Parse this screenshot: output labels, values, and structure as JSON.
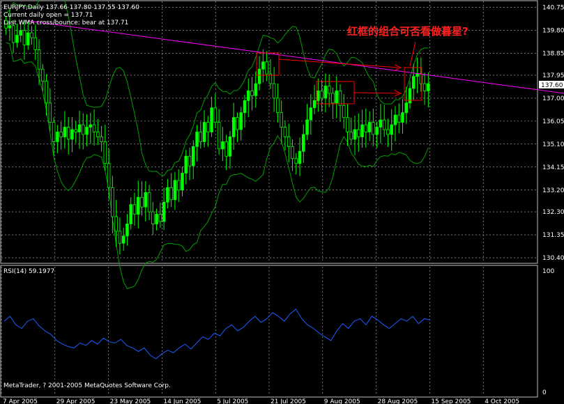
{
  "header": {
    "symbol_line": "EURJPY,Daily  137.66 137.80 137.55 137.60",
    "open_line": "Current daily open = 137.71",
    "wma_line": "Last WMA cross/bounce: bear at 137.71"
  },
  "annotation": "红框的组合可否看做暮星?",
  "copyright": "MetaTrader, ? 2001-2005 MetaQuotes Software Corp.",
  "current_price": "137.60",
  "colors": {
    "background": "#000000",
    "candle_up": "#00ff00",
    "candle_down": "#00ff00",
    "bands": "#00a000",
    "trendline": "#ff00ff",
    "rsi": "#1e5cff",
    "boxes": "#ff0000",
    "grid": "#c0c0c0"
  },
  "chart_data": [
    {
      "type": "candlestick",
      "title": "EURJPY,Daily",
      "y_ticks": [
        140.75,
        139.8,
        138.85,
        137.95,
        137.0,
        136.05,
        135.1,
        134.15,
        133.2,
        132.3,
        131.35,
        130.4
      ],
      "ylim": [
        130.2,
        141.0
      ],
      "x_ticks": [
        "7 Apr 2005",
        "29 Apr 2005",
        "23 May 2005",
        "14 Jun 2005",
        "5 Jul 2005",
        "21 Jul 2005",
        "9 Aug 2005",
        "28 Aug 2005",
        "15 Sep 2005",
        "4 Oct 2005"
      ],
      "closes_approx": [
        139.9,
        140.0,
        139.3,
        139.6,
        139.8,
        139.2,
        139.7,
        139.5,
        139.0,
        138.2,
        137.7,
        136.8,
        136.0,
        135.2,
        135.6,
        135.4,
        135.8,
        135.3,
        135.7,
        135.6,
        135.9,
        135.5,
        135.8,
        135.9,
        135.6,
        135.4,
        135.2,
        134.3,
        133.3,
        132.1,
        131.5,
        131.0,
        131.3,
        131.8,
        132.6,
        132.2,
        132.9,
        132.5,
        133.1,
        132.3,
        131.8,
        132.2,
        131.9,
        132.7,
        133.3,
        132.8,
        133.6,
        133.2,
        133.9,
        134.6,
        134.2,
        135.0,
        135.6,
        135.2,
        136.0,
        135.6,
        136.6,
        136.0,
        134.9,
        135.2,
        134.6,
        135.4,
        136.2,
        135.7,
        136.4,
        136.9,
        137.3,
        137.1,
        137.6,
        138.2,
        138.5,
        138.0,
        137.6,
        137.0,
        136.4,
        135.8,
        135.4,
        135.0,
        134.5,
        134.3,
        134.8,
        135.5,
        136.1,
        136.6,
        136.9,
        137.3,
        137.0,
        137.5,
        137.2,
        136.8,
        137.3,
        136.7,
        136.2,
        135.6,
        135.3,
        135.7,
        135.4,
        135.9,
        135.6,
        136.0,
        135.5,
        135.8,
        136.1,
        135.7,
        135.5,
        135.9,
        136.3,
        136.0,
        136.4,
        136.8,
        137.4,
        137.9,
        138.0,
        137.6,
        137.3,
        137.6
      ],
      "indicators": [
        "Bollinger bands",
        "trendline",
        "annotation boxes"
      ]
    },
    {
      "type": "line",
      "title": "RSI(14) 59.1977",
      "y_ticks": [
        100,
        0
      ],
      "ylim": [
        0,
        100
      ],
      "series": [
        {
          "name": "RSI(14)",
          "values": [
            58,
            62,
            55,
            52,
            58,
            60,
            54,
            50,
            47,
            42,
            39,
            37,
            36,
            40,
            38,
            42,
            39,
            44,
            41,
            40,
            43,
            38,
            36,
            33,
            36,
            30,
            27,
            31,
            34,
            32,
            36,
            39,
            35,
            40,
            45,
            43,
            48,
            46,
            52,
            55,
            50,
            53,
            58,
            62,
            57,
            60,
            65,
            62,
            58,
            64,
            68,
            60,
            55,
            52,
            48,
            45,
            42,
            50,
            56,
            52,
            58,
            60,
            55,
            62,
            59,
            55,
            52,
            56,
            60,
            58,
            62,
            56,
            60,
            59
          ]
        }
      ]
    }
  ]
}
